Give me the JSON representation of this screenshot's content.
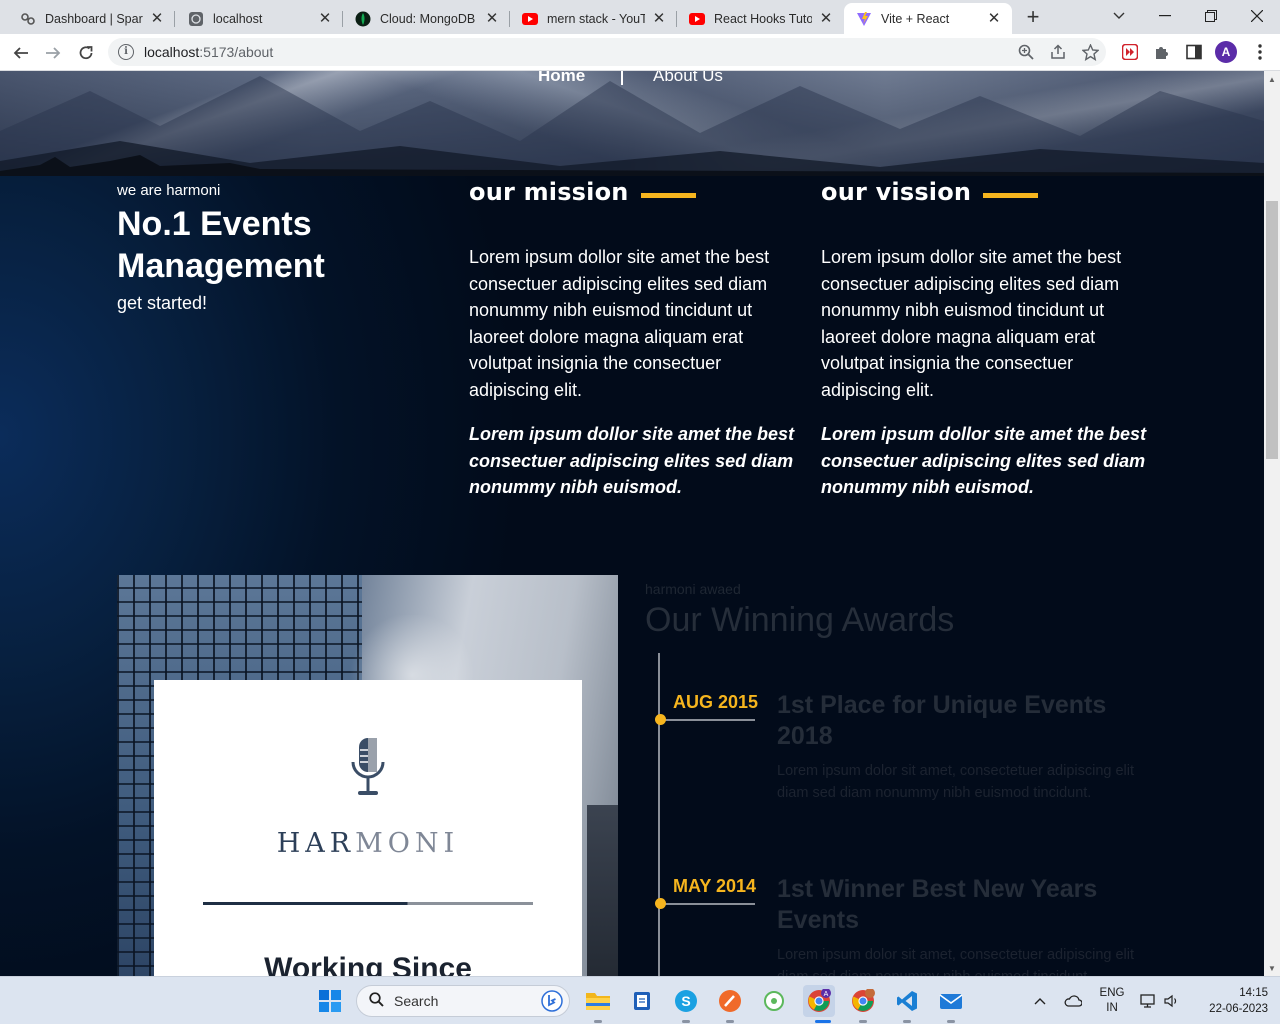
{
  "browser": {
    "tabs": [
      {
        "title": "Dashboard | Sparks",
        "icon": "sparks-icon",
        "active": false
      },
      {
        "title": "localhost",
        "icon": "globe-icon",
        "active": false
      },
      {
        "title": "Cloud: MongoDB C",
        "icon": "mongodb-icon",
        "active": false
      },
      {
        "title": "mern stack - YouTu",
        "icon": "youtube-icon",
        "active": false
      },
      {
        "title": "React Hooks Tutori",
        "icon": "youtube-icon",
        "active": false
      },
      {
        "title": "Vite + React",
        "icon": "vite-icon",
        "active": true
      }
    ],
    "url_host": "localhost",
    "url_path": ":5173/about",
    "profile_initial": "A"
  },
  "page": {
    "nav": {
      "home": "Home",
      "about": "About Us"
    },
    "intro": {
      "eyebrow": "we are harmoni",
      "title": "No.1 Events Management",
      "cta": "get started!"
    },
    "mission": {
      "heading": "our mission",
      "body": "Lorem ipsum dollor site amet the best consectuer adipiscing elites sed diam nonummy nibh euismod tincidunt ut laoreet dolore magna aliquam erat volutpat insignia the consectuer adipiscing elit.",
      "emphasis": "Lorem ipsum dollor site amet the best consectuer adipiscing elites sed diam nonummy nibh euismod."
    },
    "vision": {
      "heading": "our vission",
      "body": "Lorem ipsum dollor site amet the best consectuer adipiscing elites sed diam nonummy nibh euismod tincidunt ut laoreet dolore magna aliquam erat volutpat insignia the consectuer adipiscing elit.",
      "emphasis": "Lorem ipsum dollor site amet the best consectuer adipiscing elites sed diam nonummy nibh euismod."
    },
    "card": {
      "brand_a": "HAR",
      "brand_b": "MONI",
      "since": "Working Since"
    },
    "awards": {
      "eyebrow": "harmoni awaed",
      "heading": "Our Winning Awards",
      "items": [
        {
          "date": "AUG 2015",
          "title": "1st Place for Unique Events 2018",
          "desc": "Lorem ipsum dolor sit amet, consectetuer adipiscing elit diam sed diam nonummy nibh euismod tincidunt."
        },
        {
          "date": "MAY 2014",
          "title": "1st Winner Best New Years Events",
          "desc": "Lorem ipsum dolor sit amet, consectetuer adipiscing elit diam sed diam nonummy nibh euismod tincidunt."
        }
      ]
    },
    "accent_color": "#f6b51e"
  },
  "taskbar": {
    "search_label": "Search",
    "lang_line1": "ENG",
    "lang_line2": "IN",
    "time": "14:15",
    "date": "22-06-2023"
  }
}
